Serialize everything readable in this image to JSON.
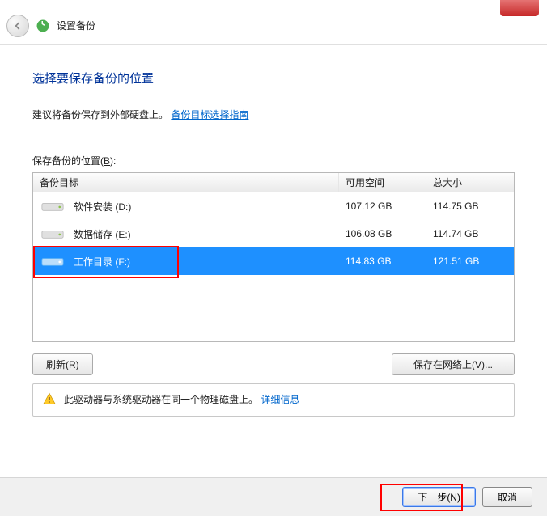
{
  "header": {
    "title": "设置备份"
  },
  "page": {
    "title": "选择要保存备份的位置",
    "advice_text": "建议将备份保存到外部硬盘上。",
    "advice_link": "备份目标选择指南"
  },
  "list": {
    "label_pre": "保存备份的位置(",
    "label_key": "B",
    "label_post": "):",
    "columns": {
      "target": "备份目标",
      "free": "可用空间",
      "total": "总大小"
    },
    "rows": [
      {
        "name": "软件安装 (D:)",
        "free": "107.12 GB",
        "total": "114.75 GB",
        "selected": false
      },
      {
        "name": "数据储存 (E:)",
        "free": "106.08 GB",
        "total": "114.74 GB",
        "selected": false
      },
      {
        "name": "工作目录 (F:)",
        "free": "114.83 GB",
        "total": "121.51 GB",
        "selected": true
      }
    ]
  },
  "buttons": {
    "refresh": "刷新(R)",
    "save_network": "保存在网络上(V)...",
    "next": "下一步(N)",
    "cancel": "取消"
  },
  "warning": {
    "text": "此驱动器与系统驱动器在同一个物理磁盘上。",
    "link": "详细信息"
  }
}
